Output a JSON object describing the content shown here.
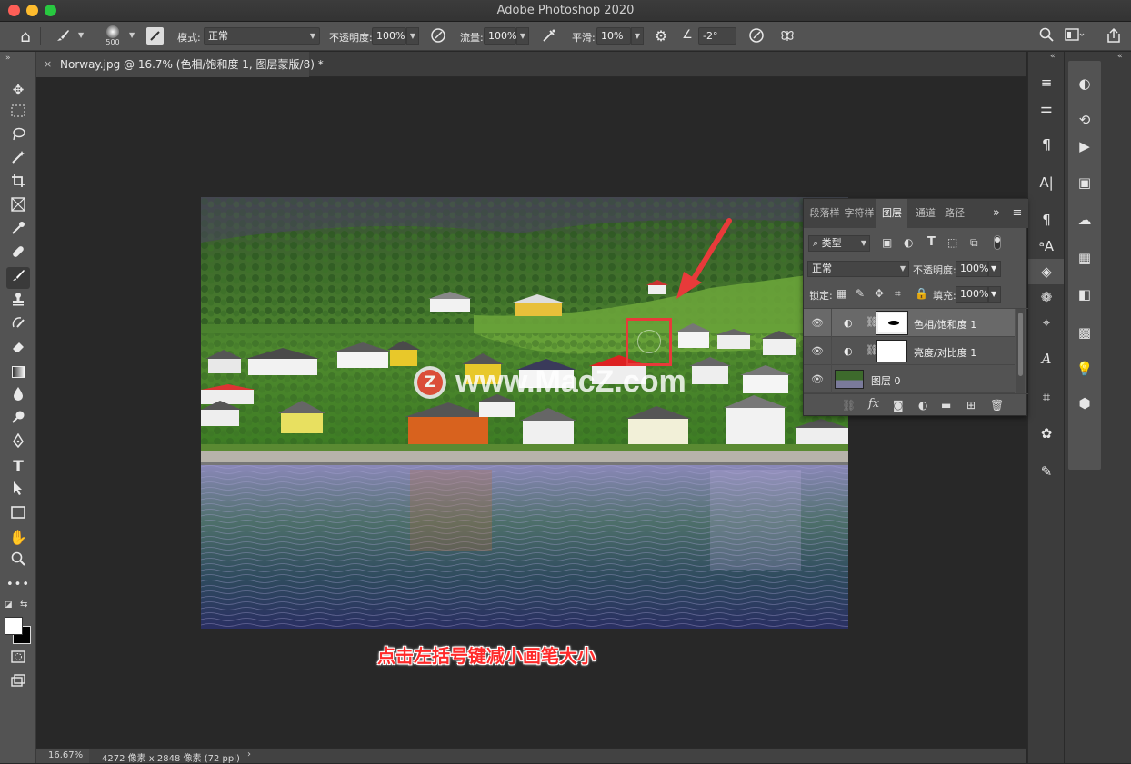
{
  "window": {
    "title": "Adobe Photoshop 2020"
  },
  "options_bar": {
    "brush_size": "500",
    "mode_label": "模式:",
    "mode_value": "正常",
    "opacity_label": "不透明度:",
    "opacity_value": "100%",
    "flow_label": "流量:",
    "flow_value": "100%",
    "smoothing_label": "平滑:",
    "smoothing_value": "10%",
    "angle_value": "-2°"
  },
  "document_tab": {
    "label": "Norway.jpg @ 16.7% (色相/饱和度 1, 图层蒙版/8) *",
    "close": "×"
  },
  "layers_panel": {
    "tabs": [
      "段落样",
      "字符样",
      "图层",
      "通道",
      "路径"
    ],
    "active_tab": "图层",
    "filter_kind": "类型",
    "blend_mode": "正常",
    "opacity_label": "不透明度:",
    "opacity_value": "100%",
    "lock_label": "锁定:",
    "fill_label": "填充:",
    "fill_value": "100%",
    "layers": [
      {
        "name": "色相/饱和度 1",
        "selected": true
      },
      {
        "name": "亮度/对比度 1",
        "selected": false
      },
      {
        "name": "图层 0",
        "selected": false
      }
    ]
  },
  "status_bar": {
    "zoom": "16.67%",
    "doc_info": "4272 像素 x 2848 像素 (72 ppi)"
  },
  "watermark": {
    "text": "www.MacZ.com",
    "badge": "Z"
  },
  "caption": "点击左括号键减小画笔大小",
  "colors": {
    "highlight_red": "#e83a3a",
    "panel_bg": "#535353",
    "app_bg": "#282828"
  }
}
